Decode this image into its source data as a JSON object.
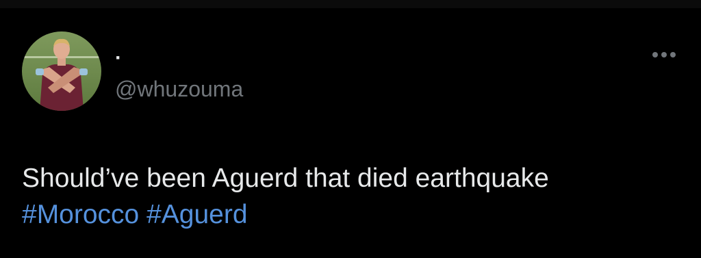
{
  "tweet": {
    "display_name": "·",
    "handle": "@whuzouma",
    "text": "Should’ve been Aguerd that died  earthquake",
    "hashtags": [
      "#Morocco",
      "#Aguerd"
    ]
  },
  "icons": {
    "more": "more-horizontal-icon",
    "avatar": "user-avatar"
  },
  "colors": {
    "background": "#000000",
    "text": "#e7e9ea",
    "handle": "#71767b",
    "hashtag": "#5591dc"
  }
}
